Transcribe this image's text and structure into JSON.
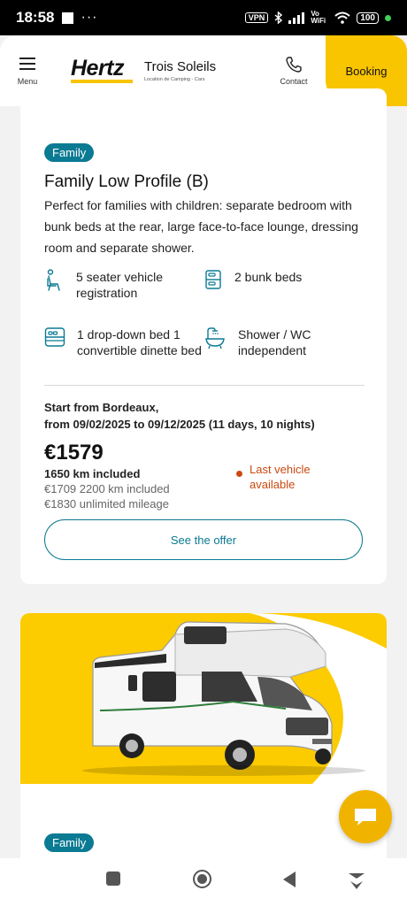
{
  "status_bar": {
    "time": "18:58",
    "dots": "···",
    "vpn": "VPN",
    "network": "Vo WiFi",
    "battery": "100"
  },
  "header": {
    "menu_label": "Menu",
    "logo_text": "Hertz",
    "brand_name": "Trois Soleils",
    "brand_sub": "Location de Camping - Cars",
    "contact_label": "Contact",
    "booking_label": "Booking"
  },
  "offer": {
    "badge": "Family",
    "title": "Family Low Profile (B)",
    "description": "Perfect for families with children: separate bedroom with bunk beds at the rear, large face-to-face lounge, dressing room and separate shower.",
    "features": [
      {
        "icon": "seat-icon",
        "label": "5 seater vehicle registration"
      },
      {
        "icon": "bunk-bed-icon",
        "label": "2 bunk beds"
      },
      {
        "icon": "bed-icon",
        "label": "1 drop-down bed 1 convertible dinette bed"
      },
      {
        "icon": "shower-icon",
        "label": "Shower / WC independent"
      }
    ],
    "start_line1": "Start from Bordeaux,",
    "start_line2": "from 09/02/2025 to 09/12/2025 (11 days, 10 nights)",
    "price": "€1579",
    "km_included": "1650 km included",
    "alt_price_1": "€1709 2200 km included",
    "alt_price_2": "€1830 unlimited mileage",
    "availability": "Last vehicle available",
    "cta_label": "See the offer"
  },
  "next_offer": {
    "badge": "Family"
  },
  "colors": {
    "brand_yellow": "#f9c400",
    "accent_teal": "#0b7a93",
    "alert_orange": "#c94a10"
  }
}
